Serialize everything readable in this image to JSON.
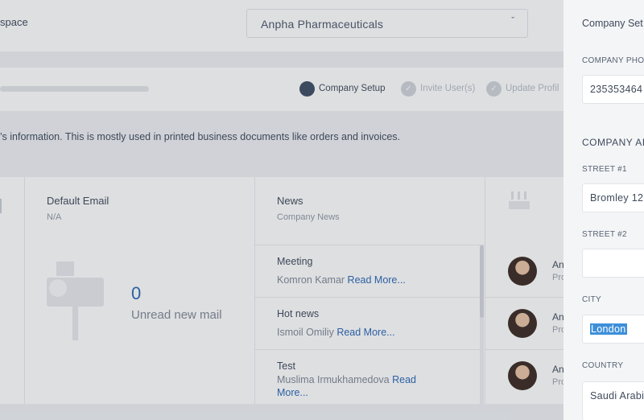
{
  "workspace": {
    "label": "space",
    "selected": "Anpha Pharmaceuticals",
    "chevron": "ˇ"
  },
  "steps": [
    {
      "label": "Company Setup",
      "state": "active"
    },
    {
      "label": "Invite User(s)",
      "state": "pending",
      "check": "✓"
    },
    {
      "label": "Update Profil",
      "state": "pending",
      "check": "✓"
    }
  ],
  "info_text": "’s information. This is mostly used in printed business documents like orders and invoices.",
  "email_widget": {
    "title": "Default Email",
    "value": "N/A",
    "count": "0",
    "count_label": "Unread new mail"
  },
  "news_widget": {
    "title": "News",
    "subtitle": "Company News",
    "read_more": "Read More...",
    "items": [
      {
        "title": "Meeting",
        "author": "Komron Kamar"
      },
      {
        "title": "Hot news",
        "author": "Ismoil Omiliy"
      },
      {
        "title": "Test",
        "author": "Muslima Irmukhamedova",
        "read_more_a": "Read",
        "read_more_b": "More..."
      }
    ]
  },
  "users_widget": {
    "rows": [
      {
        "name": "An",
        "role": "Pro"
      },
      {
        "name": "An",
        "role": "Pro"
      },
      {
        "name": "An",
        "role": "Pro"
      }
    ]
  },
  "drawer": {
    "title": "Company Set",
    "phone_label": "COMPANY PHO",
    "phone_value": "235353464",
    "address_section": "COMPANY AI",
    "street1_label": "STREET #1",
    "street1_value": "Bromley 12",
    "street2_label": "STREET #2",
    "street2_value": "",
    "city_label": "CITY",
    "city_value": "London",
    "country_label": "COUNTRY",
    "country_value": "Saudi Arabi"
  },
  "colors": {
    "accent": "#2a67b5",
    "selection": "#3d8fd9",
    "step_active": "#3b4c63"
  }
}
